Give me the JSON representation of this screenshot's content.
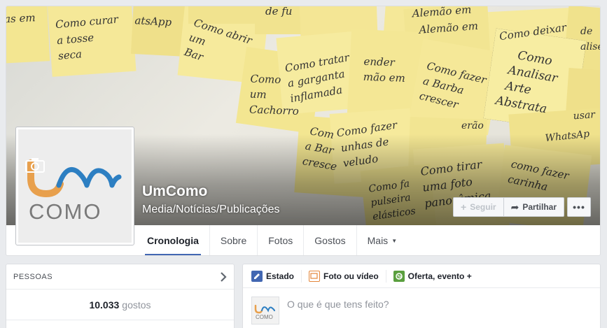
{
  "page": {
    "name": "UmComo",
    "category": "Media/Notícias/Publicações"
  },
  "logo": {
    "top": "UMCOMO",
    "bottom": "COMO"
  },
  "cover": {
    "notes": [
      "Como curar a tosse seca",
      "Como abrir um Bar",
      "Como tratar a garganta inflamada",
      "Como fazer a Barba crescer",
      "Como Analisar Arte Abstrata",
      "Como deixar de ...",
      "Como fazer unhas de veludo",
      "Como tirar uma foto panorâmica",
      "Como fazer carinha ..."
    ]
  },
  "actions": {
    "follow": "Seguir",
    "share": "Partilhar",
    "more": "•••"
  },
  "tabs": [
    {
      "label": "Cronologia",
      "active": true
    },
    {
      "label": "Sobre"
    },
    {
      "label": "Fotos"
    },
    {
      "label": "Gostos"
    },
    {
      "label": "Mais"
    }
  ],
  "people": {
    "title": "PESSOAS",
    "count": "10.033",
    "unit": "gostos"
  },
  "composer": {
    "tabs": [
      "Estado",
      "Foto ou vídeo",
      "Oferta, evento +"
    ],
    "placeholder": "O que é que tens feito?"
  },
  "colors": {
    "accent": "#4267b2",
    "note": "#f5e898",
    "logo_orange": "#e8a04d",
    "logo_blue": "#2d7fc2",
    "logo_gray": "#7a7a7a"
  }
}
